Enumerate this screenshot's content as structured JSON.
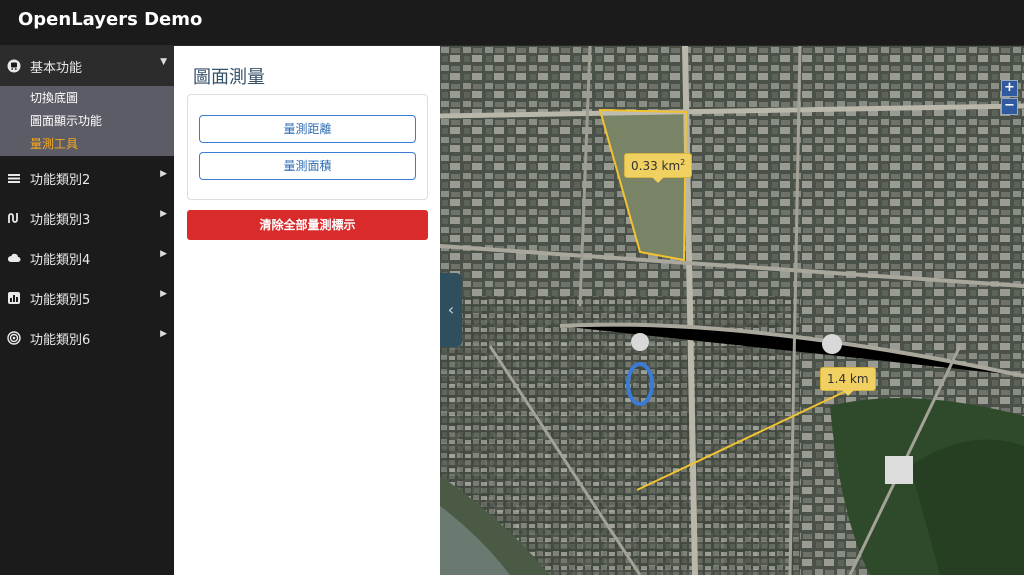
{
  "app": {
    "title": "OpenLayers Demo"
  },
  "sidebar": {
    "items": [
      {
        "label": "基本功能",
        "icon": "train-icon",
        "sub": [
          "切換底圖",
          "圖面顯示功能",
          "量測工具"
        ],
        "active_sub": "量測工具"
      },
      {
        "label": "功能類別2",
        "icon": "layers-icon"
      },
      {
        "label": "功能類別3",
        "icon": "route-icon"
      },
      {
        "label": "功能類別4",
        "icon": "cloud-icon"
      },
      {
        "label": "功能類別5",
        "icon": "chart-icon"
      },
      {
        "label": "功能類別6",
        "icon": "target-icon"
      }
    ]
  },
  "panel": {
    "title": "圖面測量",
    "measure_distance": "量測距離",
    "measure_area": "量測面積",
    "clear_all": "清除全部量測標示"
  },
  "map": {
    "zoom_in": "+",
    "zoom_out": "−",
    "collapse": "‹",
    "area_value": "0.33 km",
    "area_unit_sup": "2",
    "distance_value": "1.4 km",
    "measure_color": "#f2c230"
  }
}
